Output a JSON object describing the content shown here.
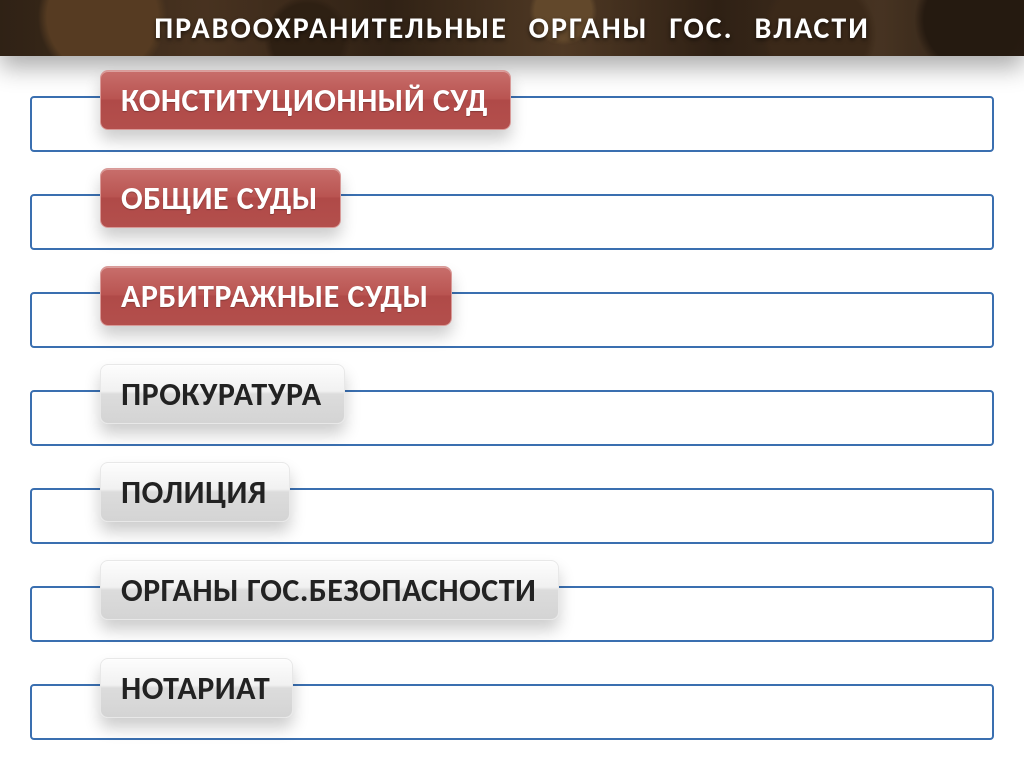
{
  "title": "ПРАВООХРАНИТЕЛЬНЫЕ ОРГАНЫ ГОС. ВЛАСТИ",
  "items": [
    {
      "label": "КОНСТИТУЦИОННЫЙ СУД",
      "style": "red"
    },
    {
      "label": "ОБЩИЕ СУДЫ",
      "style": "red"
    },
    {
      "label": "АРБИТРАЖНЫЕ СУДЫ",
      "style": "red"
    },
    {
      "label": "ПРОКУРАТУРА",
      "style": "gray"
    },
    {
      "label": "ПОЛИЦИЯ",
      "style": "gray"
    },
    {
      "label": "ОРГАНЫ ГОС.БЕЗОПАСНОСТИ",
      "style": "gray"
    },
    {
      "label": "НОТАРИАТ",
      "style": "gray"
    }
  ]
}
